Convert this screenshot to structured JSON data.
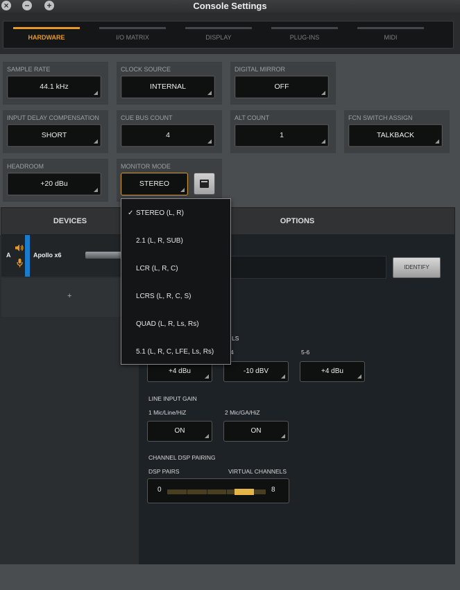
{
  "window": {
    "title": "Console Settings"
  },
  "tabs": [
    {
      "label": "HARDWARE",
      "active": true
    },
    {
      "label": "I/O MATRIX"
    },
    {
      "label": "DISPLAY"
    },
    {
      "label": "PLUG-INS"
    },
    {
      "label": "MIDI"
    }
  ],
  "settings": {
    "sample_rate": {
      "label": "SAMPLE RATE",
      "value": "44.1 kHz"
    },
    "clock_source": {
      "label": "CLOCK SOURCE",
      "value": "INTERNAL"
    },
    "digital_mirror": {
      "label": "DIGITAL MIRROR",
      "value": "OFF"
    },
    "input_delay": {
      "label": "INPUT DELAY COMPENSATION",
      "value": "SHORT"
    },
    "cue_bus_count": {
      "label": "CUE BUS COUNT",
      "value": "4"
    },
    "alt_count": {
      "label": "ALT COUNT",
      "value": "1"
    },
    "fcn_switch": {
      "label": "FCN SWITCH ASSIGN",
      "value": "TALKBACK"
    },
    "headroom": {
      "label": "HEADROOM",
      "value": "+20 dBu"
    },
    "monitor_mode": {
      "label": "MONITOR MODE",
      "value": "STEREO"
    }
  },
  "monitor_menu": {
    "items": [
      {
        "label": "STEREO (L, R)",
        "checked": true,
        "check": "✓"
      },
      {
        "label": "2.1 (L, R, SUB)"
      },
      {
        "label": "LCR (L, R, C)"
      },
      {
        "label": "LCRS (L, R, C, S)"
      },
      {
        "label": "QUAD (L, R, Ls, Rs)"
      },
      {
        "label": "5.1 (L, R, C, LFE, Ls, Rs)"
      }
    ]
  },
  "panels": {
    "devices": "DEVICES",
    "options": "OPTIONS"
  },
  "devices": {
    "items": [
      {
        "slot": "A",
        "name": "Apollo x6",
        "color": "#1a7ccf"
      }
    ],
    "add": "+"
  },
  "options": {
    "identify": "IDENTIFY",
    "levels_label_partial": "LS",
    "level_col_partial": "4",
    "level_col_56": "5-6",
    "levels": [
      "+4 dBu",
      "-10 dBV",
      "+4 dBu"
    ],
    "line_input_gain": {
      "title": "LINE INPUT GAIN",
      "ch1": {
        "label": "1 Mic/Line/HiZ",
        "value": "ON"
      },
      "ch2": {
        "label": "2 Mic/GA/HiZ",
        "value": "ON"
      }
    },
    "dsp_pairing": {
      "title": "CHANNEL DSP PAIRING",
      "left_label": "DSP PAIRS",
      "right_label": "VIRTUAL CHANNELS",
      "min": "0",
      "max": "8",
      "position_fraction": 0.85,
      "accent": "#e6b54a"
    }
  },
  "colors": {
    "accent": "#e89a25",
    "device_strip": "#1a7ccf"
  }
}
